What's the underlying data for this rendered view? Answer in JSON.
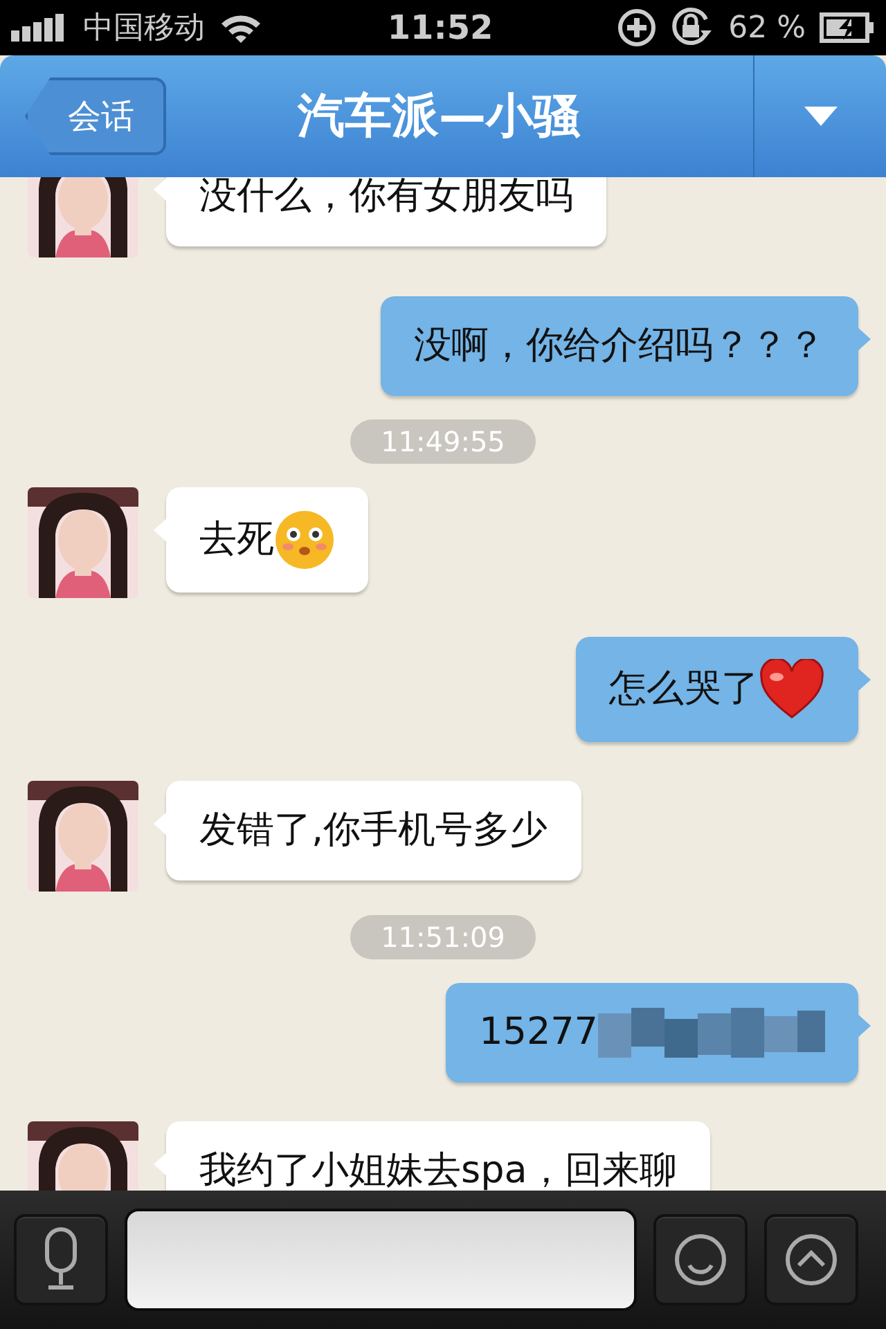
{
  "status_bar": {
    "carrier": "中国移动",
    "time": "11:52",
    "battery": "62 %"
  },
  "nav": {
    "back": "会话",
    "title": "汽车派—小骚"
  },
  "messages": [
    {
      "kind": "message",
      "outgoing": false,
      "text": "没什么，你有女朋友吗"
    },
    {
      "kind": "message",
      "outgoing": true,
      "text": "没啊，你给介绍吗？？？"
    },
    {
      "kind": "time",
      "text": "11:49:55"
    },
    {
      "kind": "message",
      "outgoing": false,
      "text": "去死",
      "emoji": {
        "kind": "face"
      }
    },
    {
      "kind": "message",
      "outgoing": true,
      "text": "怎么哭了",
      "emoji": {
        "kind": "heart"
      }
    },
    {
      "kind": "message",
      "outgoing": false,
      "text": "发错了,你手机号多少"
    },
    {
      "kind": "time",
      "text": "11:51:09"
    },
    {
      "kind": "message",
      "outgoing": true,
      "text": "15277",
      "redacted": true
    },
    {
      "kind": "message",
      "outgoing": false,
      "text": "我约了小姐妹去spa，回来聊"
    }
  ]
}
